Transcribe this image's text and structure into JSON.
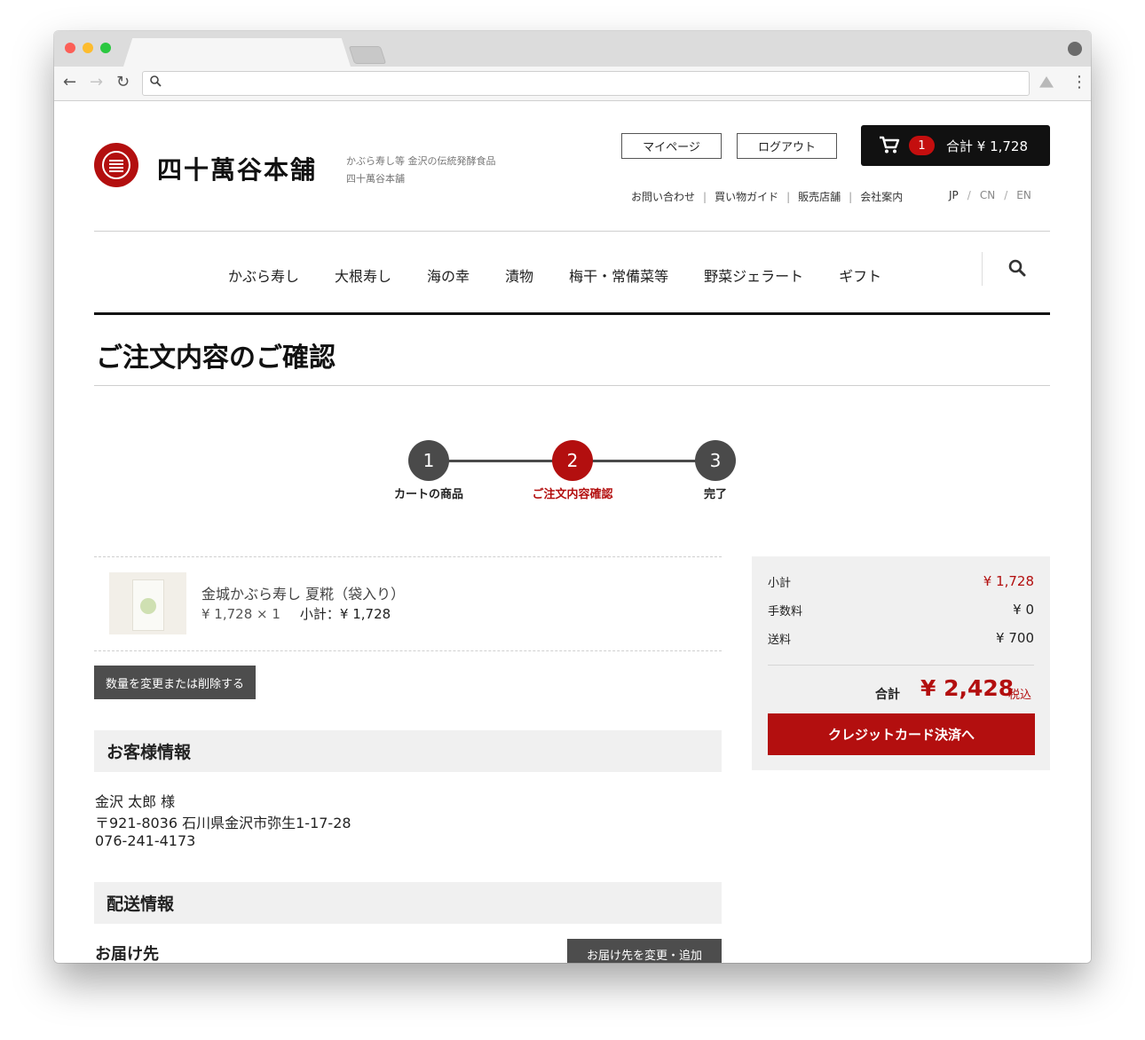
{
  "header": {
    "logo_text": "四十萬谷本舗",
    "tagline_line1": "かぶら寿し等 金沢の伝統発酵食品",
    "tagline_line2": "四十萬谷本舗",
    "mypage_label": "マイページ",
    "logout_label": "ログアウト",
    "cart_count": "1",
    "cart_total": "合計 ¥ 1,728",
    "utility_links": [
      "お問い合わせ",
      "買い物ガイド",
      "販売店舗",
      "会社案内"
    ],
    "languages": [
      "JP",
      "CN",
      "EN"
    ]
  },
  "nav": {
    "items": [
      "かぶら寿し",
      "大根寿し",
      "海の幸",
      "漬物",
      "梅干・常備菜等",
      "野菜ジェラート",
      "ギフト"
    ]
  },
  "page": {
    "title": "ご注文内容のご確認"
  },
  "steps": [
    {
      "number": "1",
      "label": "カートの商品"
    },
    {
      "number": "2",
      "label": "ご注文内容確認"
    },
    {
      "number": "3",
      "label": "完了"
    }
  ],
  "steps_active_index": 1,
  "order_item": {
    "name": "金城かぶら寿し 夏糀（袋入り）",
    "price_qty": "¥ 1,728 × 1",
    "subtotal": "小計：¥ 1,728"
  },
  "edit_button_label": "数量を変更または削除する",
  "customer": {
    "section_title": "お客様情報",
    "name": "金沢 太郎 様",
    "address": "〒921-8036 石川県金沢市弥生1-17-28",
    "phone": "076-241-4173"
  },
  "delivery": {
    "section_title": "配送情報",
    "destination_label": "お届け先",
    "change_button_label": "お届け先を変更・追加"
  },
  "summary": {
    "subtotal_label": "小計",
    "subtotal_value": "¥ 1,728",
    "fee_label": "手数料",
    "fee_value": "¥ 0",
    "shipping_label": "送料",
    "shipping_value": "¥ 700",
    "total_label": "合計",
    "total_value": "¥ 2,428",
    "tax_label": "税込",
    "pay_button_label": "クレジットカード決済へ"
  },
  "colors": {
    "accent_red": "#b30f0f",
    "dark": "#111111",
    "panel_gray": "#f0f0f0",
    "button_gray": "#4d4d4d"
  },
  "icons": {
    "cart": "cart-icon",
    "search": "search-icon",
    "seal": "seal-logo-icon"
  }
}
